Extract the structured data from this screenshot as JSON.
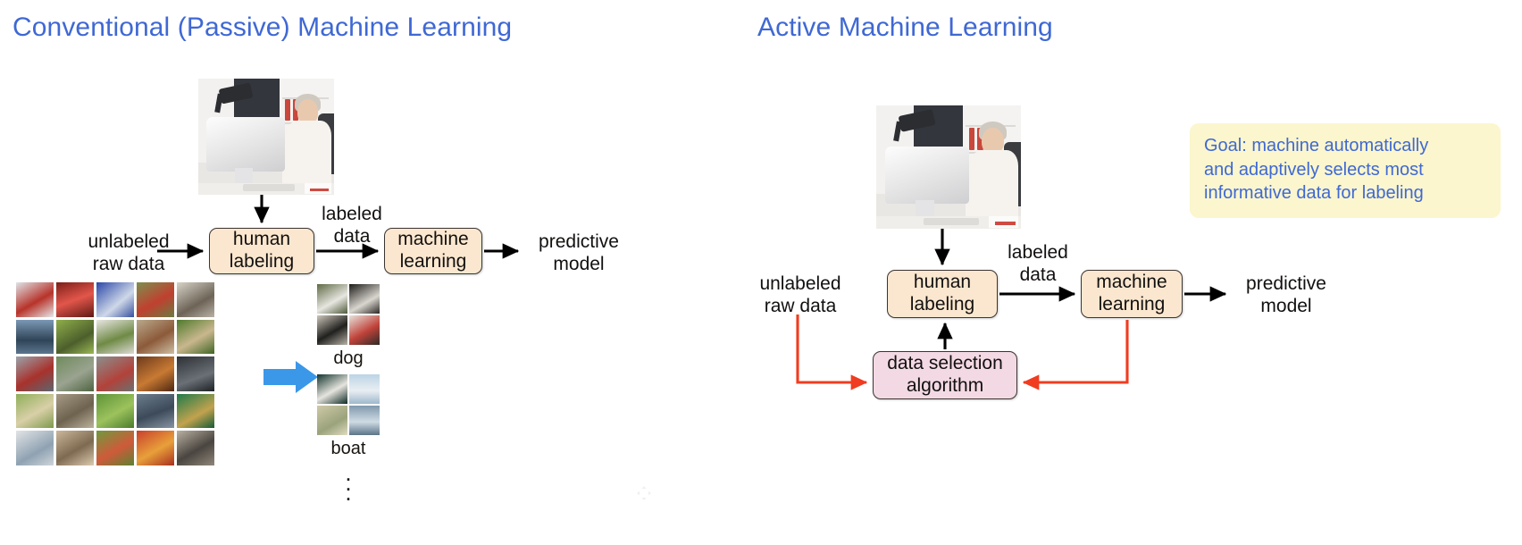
{
  "slide": {
    "background_color": "#ffffff",
    "title_color": "#3f68d4",
    "box_fill_cream": "#fbe7cf",
    "box_fill_pink": "#f3d9e4",
    "callout_fill": "#fbf6cd",
    "feedback_arrow_color": "#f03c20",
    "flow_arrow_color": "#000000",
    "blue_arrow_color": "#3b97e8"
  },
  "left_panel": {
    "title": "Conventional (Passive) Machine Learning",
    "input_label": {
      "line1": "unlabeled",
      "line2": "raw data"
    },
    "human_box": {
      "line1": "human",
      "line2": "labeling"
    },
    "edge_label": {
      "line1": "labeled",
      "line2": "data"
    },
    "machine_box": {
      "line1": "machine",
      "line2": "learning"
    },
    "output_label": {
      "line1": "predictive",
      "line2": "model"
    },
    "annotator_photo_alt": "person at desktop computer labeling data",
    "raw_data_collage_alt": "grid of unlabeled raw photographs",
    "class_groups": [
      {
        "label": "dog",
        "thumb_alt": "four dog photographs"
      },
      {
        "label": "boat",
        "thumb_alt": "four sailboat photographs"
      }
    ],
    "more_indicator": "⋮"
  },
  "right_panel": {
    "title": "Active Machine Learning",
    "input_label": {
      "line1": "unlabeled",
      "line2": "raw data"
    },
    "human_box": {
      "line1": "human",
      "line2": "labeling"
    },
    "edge_label": {
      "line1": "labeled",
      "line2": "data"
    },
    "machine_box": {
      "line1": "machine",
      "line2": "learning"
    },
    "output_label": {
      "line1": "predictive",
      "line2": "model"
    },
    "selection_box": {
      "line1": "data selection",
      "line2": "algorithm"
    },
    "annotator_photo_alt": "person at desktop computer labeling data",
    "goal_callout": {
      "line1": "Goal: machine automatically",
      "line2": "and adaptively selects most",
      "line3": "informative data for labeling"
    }
  }
}
